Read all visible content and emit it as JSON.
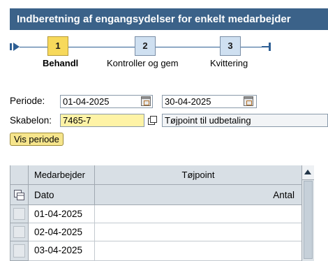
{
  "window": {
    "title": "Indberetning af engangsydelser for enkelt medarbejder"
  },
  "roadmap": {
    "steps": [
      {
        "number": "1",
        "label": "Behandl",
        "active": true
      },
      {
        "number": "2",
        "label": "Kontroller og gem",
        "active": false
      },
      {
        "number": "3",
        "label": "Kvittering",
        "active": false
      }
    ]
  },
  "form": {
    "period_label": "Periode:",
    "period_from": "01-04-2025",
    "period_to": "30-04-2025",
    "template_label": "Skabelon:",
    "template_value": "7465-7",
    "template_description": "Tøjpoint til udbetaling",
    "show_period_button": "Vis periode"
  },
  "table": {
    "header_row1": {
      "col1": "Medarbejder",
      "col2": "Tøjpoint"
    },
    "header_row2": {
      "col1": "Dato",
      "col2": "Antal"
    },
    "rows": [
      {
        "date": "01-04-2025",
        "amount": ""
      },
      {
        "date": "02-04-2025",
        "amount": ""
      },
      {
        "date": "03-04-2025",
        "amount": ""
      }
    ]
  },
  "colors": {
    "titlebar": "#3b6289",
    "active_step": "#f7d95b",
    "inactive_step": "#cfe0f1",
    "required_field": "#fef3a6",
    "button": "#f6e58c",
    "table_header": "#d8dfe5"
  },
  "icons": [
    "roadmap-start-icon",
    "roadmap-end-icon",
    "calendar-icon",
    "copy-icon",
    "column-settings-icon",
    "scroll-up-icon"
  ]
}
